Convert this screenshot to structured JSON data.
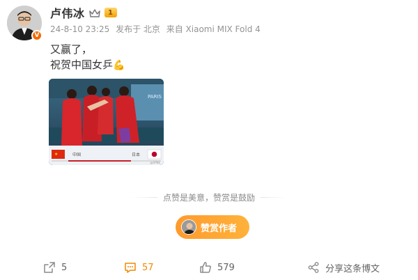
{
  "post": {
    "username": "卢伟冰",
    "level": "1",
    "verified_mark": "V",
    "date": "24-8-10 23:25",
    "location": "发布于 北京",
    "source": "来自 Xiaomi MIX Fold 4",
    "text_line1": "又赢了，",
    "text_line2": "祝贺中国女乒",
    "text_emoji": "💪"
  },
  "media": {
    "left_label": "中国",
    "right_label": "日本",
    "corner_tag": "PARIS",
    "watermark": "@XPNE"
  },
  "reward": {
    "divider_text": "点赞是美意，赞赏是鼓励",
    "button_label": "赞赏作者"
  },
  "actions": {
    "forward_count": "5",
    "comment_count": "57",
    "like_count": "579",
    "share_label": "分享这条博文"
  },
  "colors": {
    "accent_orange": "#f18900",
    "reward_gradient_start": "#ff9a2c",
    "reward_gradient_end": "#ffb23c",
    "meta_gray": "#939393"
  },
  "icons": {
    "forward": "forward-icon",
    "comment": "comment-icon",
    "like": "thumbs-up-icon",
    "share": "share-icon",
    "crown": "crown-icon"
  }
}
